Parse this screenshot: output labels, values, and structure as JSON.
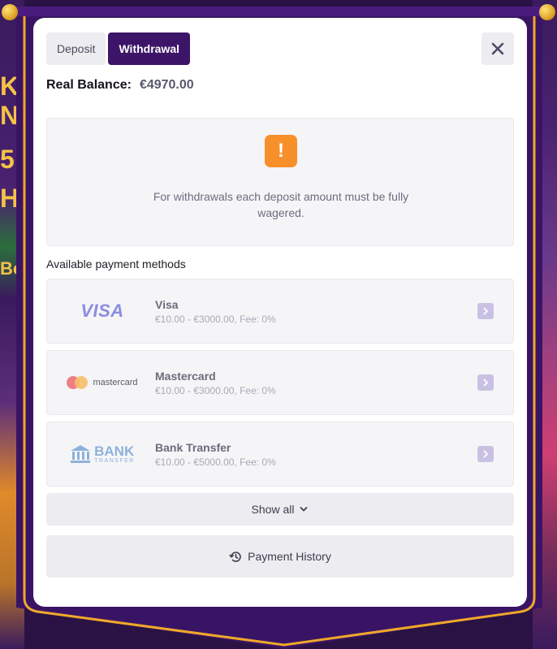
{
  "background": {
    "left_fragments": [
      "K",
      "N",
      "5",
      "H",
      "Bo"
    ]
  },
  "tabs": {
    "deposit": "Deposit",
    "withdrawal": "Withdrawal",
    "active": "withdrawal"
  },
  "close_icon": "close-icon",
  "balance": {
    "label": "Real Balance:",
    "amount": "€4970.00"
  },
  "notice": {
    "icon": "exclamation-icon",
    "text": "For withdrawals each deposit amount must be fully wagered."
  },
  "methods": {
    "title": "Available payment methods",
    "items": [
      {
        "name": "Visa",
        "details": "€10.00 - €3000.00, Fee: 0%",
        "logo_text": "VISA"
      },
      {
        "name": "Mastercard",
        "details": "€10.00 - €3000.00, Fee: 0%",
        "logo_text": "mastercard"
      },
      {
        "name": "Bank Transfer",
        "details": "€10.00 - €5000.00, Fee: 0%",
        "logo_text": "BANK",
        "logo_subtext": "TRANSFER"
      }
    ]
  },
  "show_all": "Show all",
  "payment_history": "Payment History",
  "colors": {
    "tab_active": "#3d1568",
    "warning": "#f7902a",
    "banner": "#3a1464",
    "banner_border": "#f0a82a"
  }
}
